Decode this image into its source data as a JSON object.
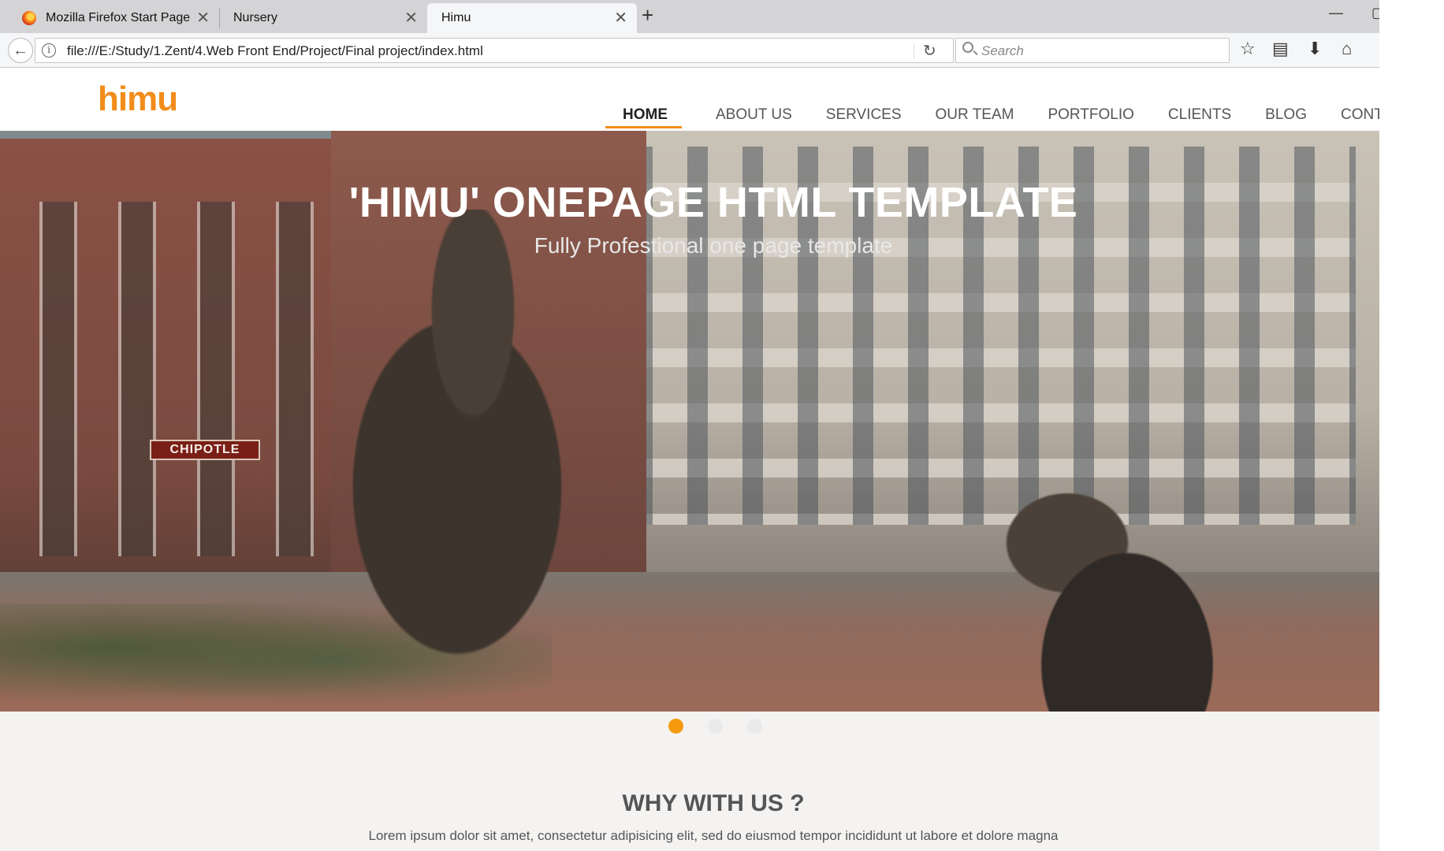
{
  "tabs": [
    {
      "title": "Mozilla Firefox Start Page",
      "icon": "firefox-icon"
    },
    {
      "title": "Nursery"
    },
    {
      "title": "Himu"
    }
  ],
  "toolbar": {
    "url": "file:///E:/Study/1.Zent/4.Web Front End/Project/Final project/index.html",
    "search_placeholder": "Search"
  },
  "site": {
    "logo": "himu",
    "menu": [
      "HOME",
      "ABOUT US",
      "SERVICES",
      "OUR TEAM",
      "PORTFOLIO",
      "CLIENTS",
      "BLOG",
      "CONTACT"
    ],
    "active_menu": "HOME",
    "accent": "#f28c1b"
  },
  "hero": {
    "title": "'HIMU' ONEPAGE HTML TEMPLATE",
    "subtitle": "Fully Profestional one page template",
    "sign_text": "CHIPOTLE",
    "slides": 3,
    "active_slide": 1
  },
  "section": {
    "title": "WHY WITH US ?",
    "text": "Lorem ipsum dolor sit amet, consectetur adipisicing elit, sed do eiusmod tempor incididunt ut labore et dolore magna"
  }
}
